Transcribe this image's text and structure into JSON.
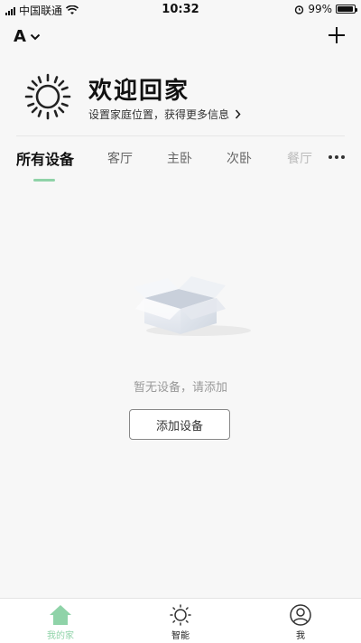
{
  "status_bar": {
    "carrier": "中国联通",
    "time": "10:32",
    "battery": "99%"
  },
  "header": {
    "home_name": "A"
  },
  "welcome": {
    "title": "欢迎回家",
    "subtitle": "设置家庭位置，获得更多信息"
  },
  "tabs": [
    {
      "label": "所有设备"
    },
    {
      "label": "客厅"
    },
    {
      "label": "主卧"
    },
    {
      "label": "次卧"
    },
    {
      "label": "餐厅"
    }
  ],
  "empty_state": {
    "message": "暂无设备，请添加",
    "button_label": "添加设备"
  },
  "bottom_nav": [
    {
      "label": "我的家",
      "icon": "home-icon"
    },
    {
      "label": "智能",
      "icon": "sun-icon"
    },
    {
      "label": "我",
      "icon": "profile-icon"
    }
  ],
  "colors": {
    "accent": "#8fd3a8",
    "background": "#f7f7f7"
  }
}
